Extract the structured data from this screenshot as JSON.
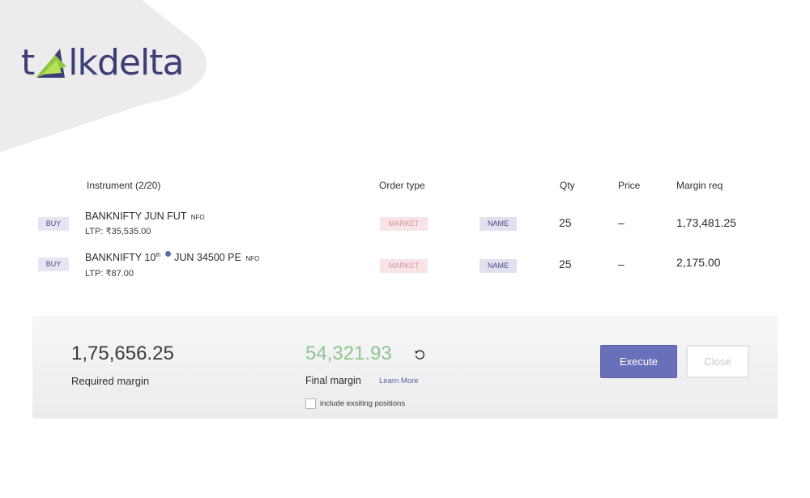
{
  "brand": {
    "logo_text_t": "t",
    "logo_text_rest": "lkdelta",
    "accent": "#8cc63f",
    "primary": "#3f3d75"
  },
  "table": {
    "headers": {
      "instrument": "Instrument (2/20)",
      "order_type": "Order type",
      "qty": "Qty",
      "price": "Price",
      "margin": "Margin req"
    },
    "rows": [
      {
        "side": "BUY",
        "name": "BANKNIFTY JUN FUT",
        "exchange": "NFO",
        "ltp": "LTP: ₹35,535.00",
        "order_type": "MARKET",
        "product": "NAME",
        "qty": "25",
        "price": "–",
        "margin": "1,73,481.25"
      },
      {
        "side": "BUY",
        "name_part1": "BANKNIFTY 10",
        "name_sup": "th",
        "name_part2": "JUN 34500 PE",
        "exchange": "NFO",
        "ltp": "LTP: ₹87.00",
        "order_type": "MARKET",
        "product": "NAME",
        "qty": "25",
        "price": "–",
        "margin": "2,175.00"
      }
    ]
  },
  "summary": {
    "required_margin_value": "1,75,656.25",
    "required_margin_label": "Required margin",
    "final_margin_value": "54,321.93",
    "final_margin_label": "Final margin",
    "learn_more": "Learn More",
    "include_positions_label": "include exsiting positions",
    "include_positions_checked": false,
    "final_margin_color": "#8fc590"
  },
  "actions": {
    "execute": "Execute",
    "close": "Close",
    "execute_color": "#6a6fb9"
  },
  "icons": {
    "refresh": "refresh-icon",
    "dot": "expiry-dot-icon"
  }
}
